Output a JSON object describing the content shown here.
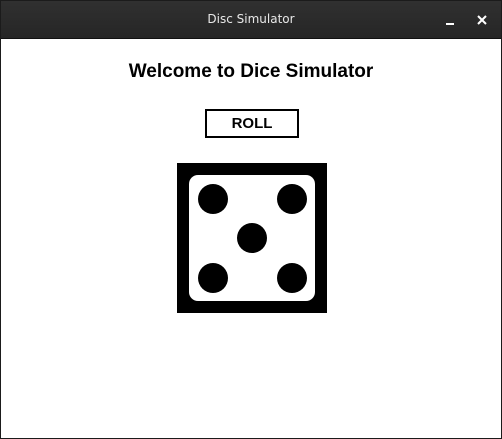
{
  "window": {
    "title": "Disc Simulator",
    "minimize_icon": "minimize-icon",
    "close_icon": "close-icon"
  },
  "main": {
    "heading": "Welcome to Dice Simulator",
    "roll_label": "ROLL"
  },
  "die": {
    "value": 5,
    "face_color": "#ffffff",
    "pip_color": "#000000",
    "frame_color": "#000000"
  }
}
